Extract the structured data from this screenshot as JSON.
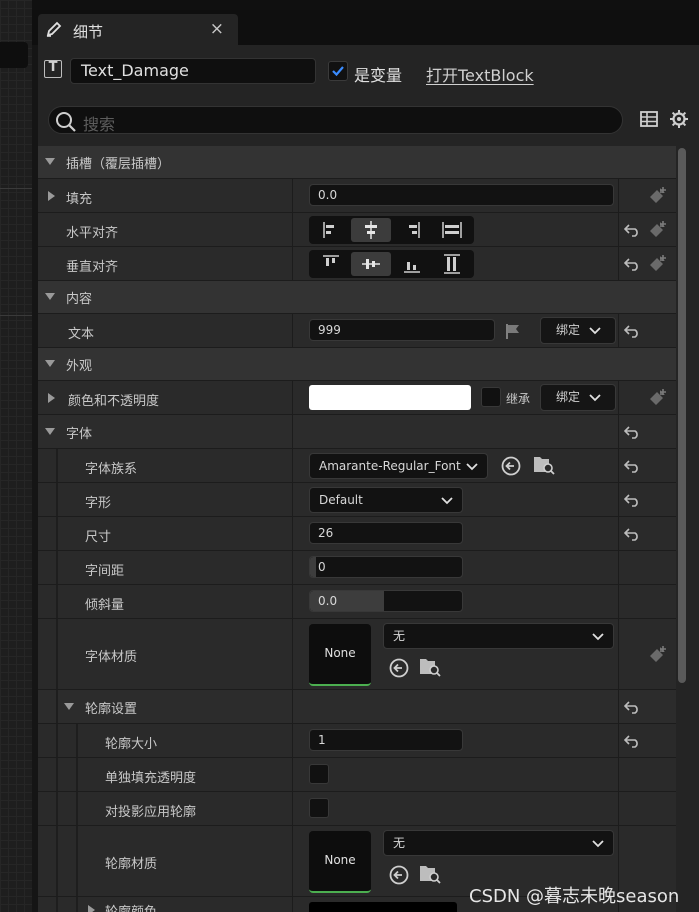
{
  "tab": {
    "title": "细节",
    "close": "×",
    "icon": "pencil-icon"
  },
  "header": {
    "widget_type_icon": "T",
    "widget_name": "Text_Damage",
    "is_variable_checked": true,
    "is_variable_label": "是变量",
    "open_link": "打开TextBlock"
  },
  "search": {
    "placeholder": "搜索"
  },
  "sections": {
    "slot": "插槽（覆层插槽）",
    "content": "内容",
    "appearance": "外观",
    "font": "字体",
    "outline": "轮廓设置"
  },
  "props": {
    "padding": {
      "label": "填充",
      "value": "0.0"
    },
    "halign": {
      "label": "水平对齐",
      "selected": "center"
    },
    "valign": {
      "label": "垂直对齐",
      "selected": "center"
    },
    "text": {
      "label": "文本",
      "value": "999",
      "bind": "绑定"
    },
    "color": {
      "label": "颜色和不透明度",
      "swatch": "#ffffff",
      "inherit": "继承",
      "bind": "绑定"
    },
    "font_family": {
      "label": "字体族系",
      "value": "Amarante-Regular_Font"
    },
    "typeface": {
      "label": "字形",
      "value": "Default"
    },
    "size": {
      "label": "尺寸",
      "value": "26"
    },
    "letter_spacing": {
      "label": "字间距",
      "value": "0"
    },
    "skew": {
      "label": "倾斜量",
      "value": "0.0"
    },
    "font_material": {
      "label": "字体材质",
      "thumb": "None",
      "value": "无"
    },
    "outline_size": {
      "label": "轮廓大小",
      "value": "1"
    },
    "separate_fill_alpha": {
      "label": "单独填充透明度"
    },
    "apply_to_shadow": {
      "label": "对投影应用轮廓"
    },
    "outline_material": {
      "label": "轮廓材质",
      "thumb": "None",
      "value": "无"
    },
    "outline_color": {
      "label": "轮廓颜色"
    }
  },
  "watermark": "CSDN @暮志未晚season"
}
